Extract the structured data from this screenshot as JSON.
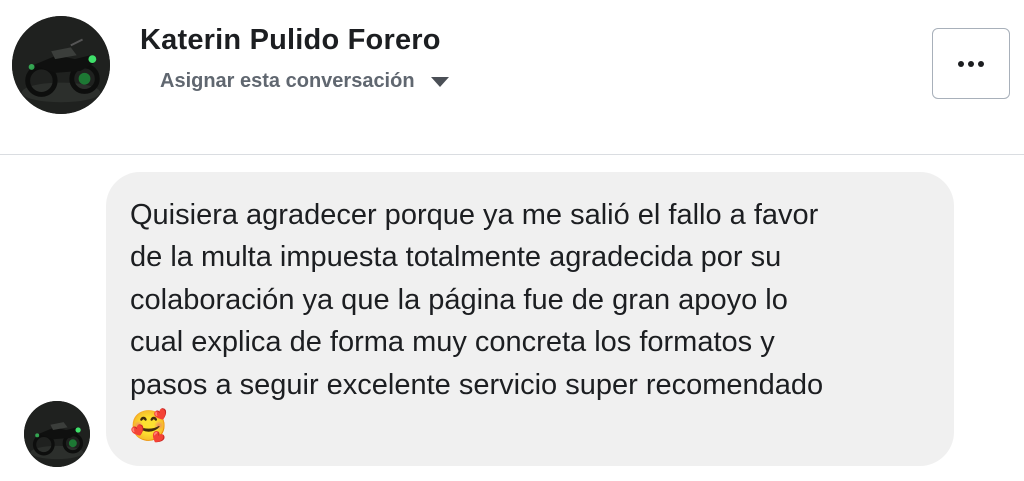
{
  "header": {
    "contact_name": "Katerin Pulido Forero",
    "assign_label": "Asignar esta conversación",
    "more_button_label": "..."
  },
  "message": {
    "text": "Quisiera agradecer porque ya me salió el fallo a favor\nde la multa impuesta totalmente agradecida por su\ncolaboración ya que la página fue de gran apoyo lo\ncual explica de forma muy concreta los formatos y\npasos a seguir excelente servicio super recomendado",
    "emoji": "🥰"
  },
  "icons": {
    "assign_dropdown": "caret-down-icon",
    "more_options": "ellipsis-icon",
    "avatar": "motorcycle-photo"
  }
}
